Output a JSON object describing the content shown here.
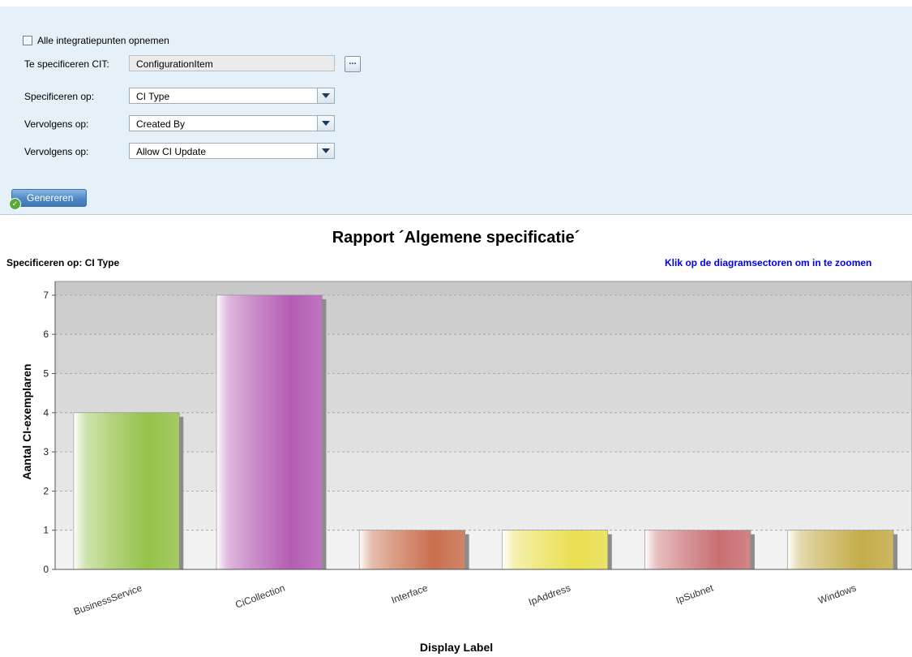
{
  "form": {
    "include_all_label": "Alle integratiepunten opnemen",
    "cit_label": "Te specificeren CIT:",
    "cit_value": "ConfigurationItem",
    "cit_browse_label": "...",
    "specify_label": "Specificeren op:",
    "specify_value": "CI Type",
    "then1_label": "Vervolgens op:",
    "then1_value": "Created By",
    "then2_label": "Vervolgens op:",
    "then2_value": "Allow CI Update",
    "generate_label": "Genereren"
  },
  "report": {
    "title": "Rapport ´Algemene specificatie´",
    "subtitle": "Specificeren op: CI Type",
    "zoom_hint": "Klik op de diagramsectoren om in te zoomen"
  },
  "chart_data": {
    "type": "bar",
    "xlabel": "Display Label",
    "ylabel": "Aantal CI-exemplaren",
    "categories": [
      "BusinessService",
      "CiCollection",
      "Interface",
      "IpAddress",
      "IpSubnet",
      "Windows"
    ],
    "values": [
      4,
      7,
      1,
      1,
      1,
      1
    ],
    "ylim": [
      0,
      7.35
    ],
    "yticks": [
      "0",
      "1",
      "2",
      "3",
      "4",
      "5",
      "6",
      "7"
    ],
    "grid": true,
    "colors": [
      "#95c24a",
      "#b45db3",
      "#c96f4e",
      "#e9df4f",
      "#c96f72",
      "#c3ac49"
    ]
  }
}
